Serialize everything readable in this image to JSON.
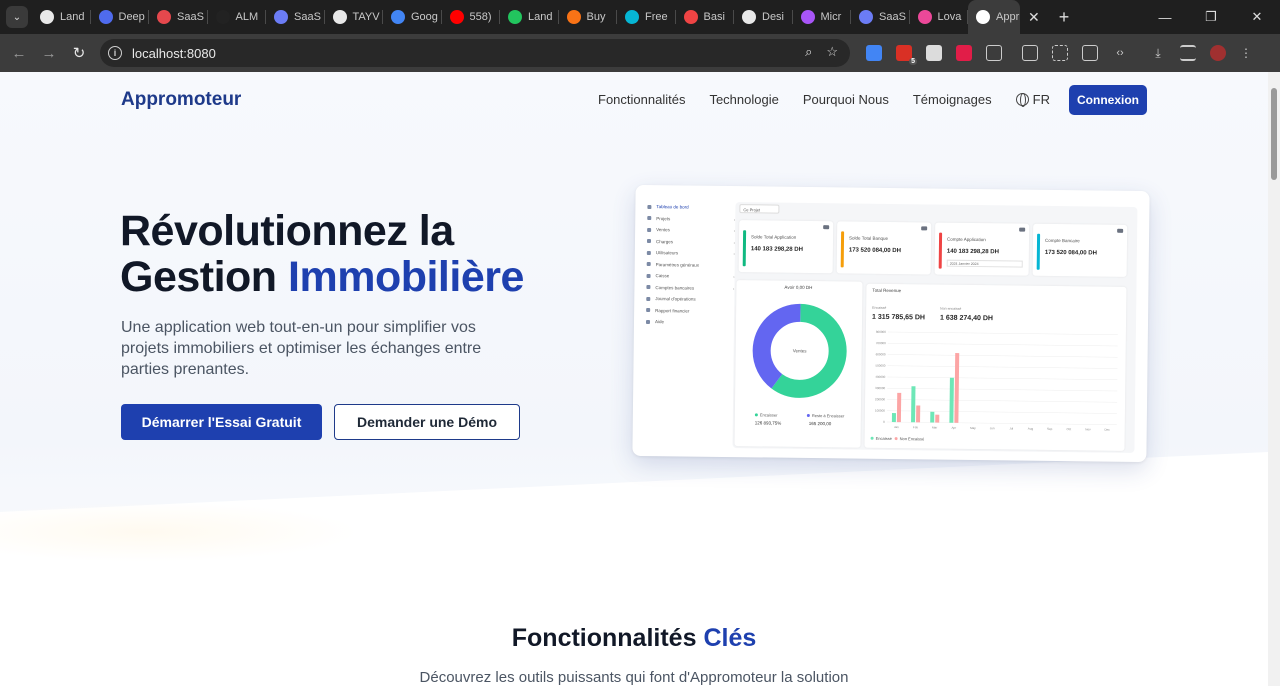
{
  "browser": {
    "tabs": [
      {
        "label": "Land",
        "color": "#e8e8e8"
      },
      {
        "label": "Deep",
        "color": "#4f6bed"
      },
      {
        "label": "SaaS",
        "color": "#e5484d"
      },
      {
        "label": "ALM",
        "color": "#222222"
      },
      {
        "label": "SaaS",
        "color": "#6b7cf5"
      },
      {
        "label": "TAYV",
        "color": "#e8e8e8"
      },
      {
        "label": "Goog",
        "color": "#4285f4"
      },
      {
        "label": "558)",
        "color": "#ff0000"
      },
      {
        "label": "Land",
        "color": "#22c55e"
      },
      {
        "label": "Buy",
        "color": "#f97316"
      },
      {
        "label": "Free",
        "color": "#06b6d4"
      },
      {
        "label": "Basi",
        "color": "#ef4444"
      },
      {
        "label": "Desi",
        "color": "#e8e8e8"
      },
      {
        "label": "Micr",
        "color": "#a855f7"
      },
      {
        "label": "SaaS",
        "color": "#6b7cf5"
      },
      {
        "label": "Lova",
        "color": "#ec4899"
      },
      {
        "label": "Appr",
        "color": "#ffffff"
      }
    ],
    "url": "localhost:8080",
    "extension_badge": "5"
  },
  "nav": {
    "logo": "Appromoteur",
    "links": [
      "Fonctionnalités",
      "Technologie",
      "Pourquoi Nous",
      "Témoignages"
    ],
    "lang": "FR",
    "login": "Connexion"
  },
  "hero": {
    "title_line1": "Révolutionnez la",
    "title_line2_a": "Gestion ",
    "title_line2_b": "Immobilière",
    "subtitle": "Une application web tout-en-un pour simplifier vos projets immobiliers et optimiser les échanges entre parties prenantes.",
    "cta_primary": "Démarrer l'Essai Gratuit",
    "cta_secondary": "Demander une Démo"
  },
  "features": {
    "title_a": "Fonctionnalités ",
    "title_b": "Clés",
    "subtitle": "Découvrez les outils puissants qui font d'Appromoteur la solution"
  },
  "mockup": {
    "sidebar": [
      "Tableau de bord",
      "Projets",
      "Ventes",
      "Charges",
      "Utilisateurs",
      "Paramètres généraux",
      "Caisse",
      "Comptes bancaires",
      "Journal d'opérations",
      "Rapport financier",
      "Aide"
    ],
    "filter": "Ce Projet",
    "cards": [
      {
        "label": "Solde Total Application",
        "value": "140 183 298,28 DH",
        "color": "#10b981"
      },
      {
        "label": "Solde Total Banque",
        "value": "173 520 084,00 DH",
        "color": "#f59e0b"
      },
      {
        "label": "Compte Application",
        "value": "140 183 298,28 DH",
        "color": "#ef4444"
      },
      {
        "label": "Compte Bancaire",
        "value": "173 520 084,00 DH",
        "color": "#06b6d4"
      }
    ],
    "card_select": "2024 Janvier 2024",
    "donut": {
      "title": "Avoir 0,00 DH",
      "center": "Ventes",
      "legend": [
        {
          "label": "Encaisser",
          "value": "126 893,75%",
          "color": "#34d399"
        },
        {
          "label": "Reste à Encaisser",
          "value": "165 200,00",
          "color": "#6366f1"
        }
      ]
    },
    "revenue": {
      "title": "Total Revenue",
      "stats": [
        {
          "label": "Encaissé",
          "value": "1 315 785,65 DH"
        },
        {
          "label": "Non encaissé",
          "value": "1 638 274,40 DH"
        }
      ],
      "legend": [
        {
          "label": "Encaissé",
          "color": "#6ee7b7"
        },
        {
          "label": "Non Encaissé",
          "color": "#fca5a5"
        }
      ]
    }
  },
  "chart_data": {
    "type": "bar",
    "title": "Total Revenue",
    "categories": [
      "Jan",
      "Feb",
      "Mar",
      "Apr",
      "May",
      "Jun",
      "Jul",
      "Aug",
      "Sep",
      "Oct",
      "Nov",
      "Dec"
    ],
    "series": [
      {
        "name": "Encaissé",
        "color": "#6ee7b7",
        "values": [
          80000,
          320000,
          95000,
          400000,
          0,
          0,
          0,
          0,
          0,
          0,
          0,
          0
        ]
      },
      {
        "name": "Non Encaissé",
        "color": "#fca5a5",
        "values": [
          260000,
          150000,
          70000,
          620000,
          0,
          0,
          0,
          0,
          0,
          0,
          0,
          0
        ]
      }
    ],
    "ylim": [
      0,
      800000
    ],
    "yticks": [
      "800000",
      "700000",
      "600000",
      "500000",
      "400000",
      "300000",
      "200000",
      "100000",
      "0"
    ],
    "donut": {
      "values": [
        60,
        40
      ],
      "colors": [
        "#34d399",
        "#6366f1"
      ]
    }
  }
}
